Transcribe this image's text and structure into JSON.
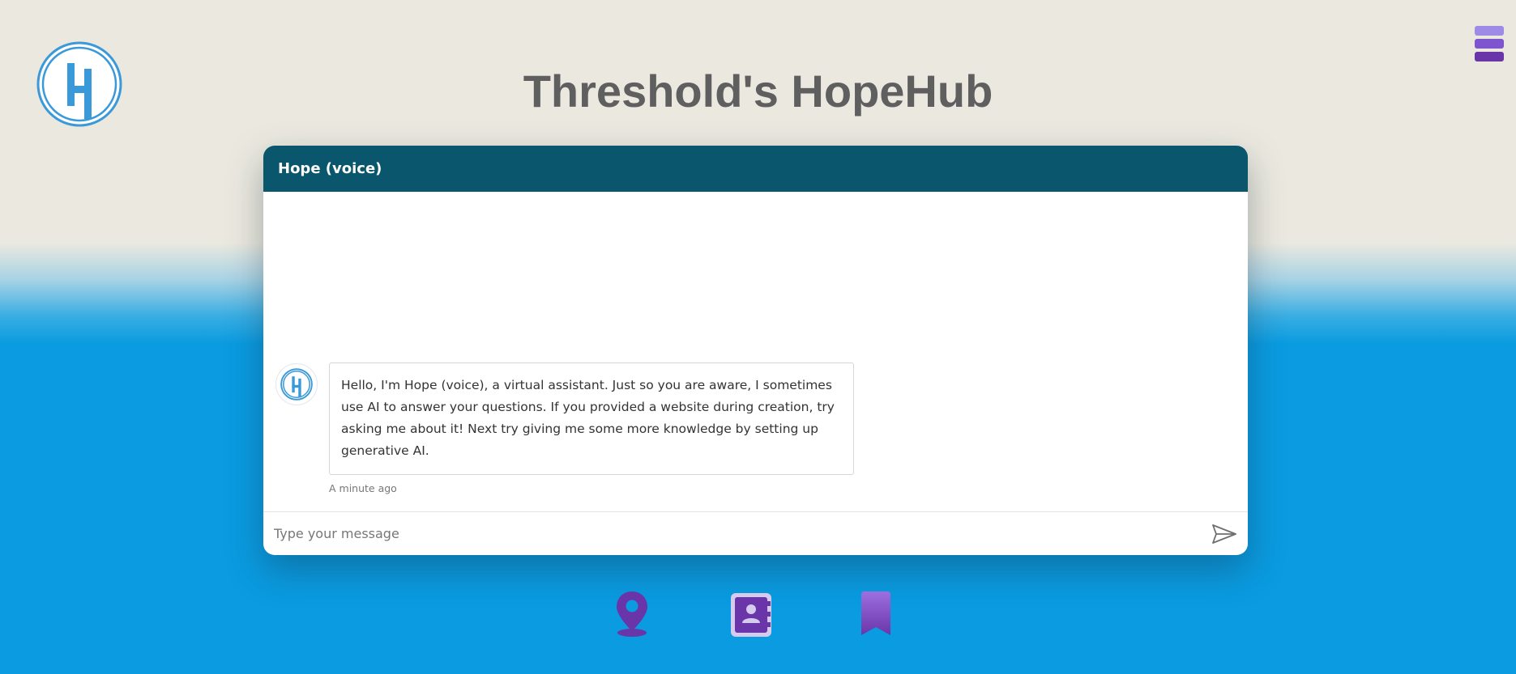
{
  "page": {
    "title": "Threshold's HopeHub"
  },
  "icons": {
    "logo": "hopehub-logo",
    "menu": "hamburger-menu-icon",
    "send": "send-arrow-icon",
    "nav": [
      "location-pin-icon",
      "contact-book-icon",
      "bookmark-icon"
    ]
  },
  "chat": {
    "header_title": "Hope (voice)",
    "messages": [
      {
        "sender": "bot",
        "text": "Hello, I'm Hope (voice), a virtual assistant. Just so you are aware, I sometimes use AI to answer your questions. If you provided a website during creation, try asking me about it! Next try giving me some more knowledge by setting up generative AI.",
        "timestamp": "A minute ago"
      }
    ],
    "input_placeholder": "Type your message",
    "input_value": ""
  },
  "colors": {
    "header_bg": "#0a566c",
    "title_text": "#5f5f5f",
    "logo_blue": "#3a99d8",
    "menu_purple": [
      "#9d8be8",
      "#7c55cf",
      "#6a35a8"
    ],
    "nav_purple": "#6a35a8",
    "sky_blue": "#0a9be0",
    "sand": "#ebe9df"
  }
}
